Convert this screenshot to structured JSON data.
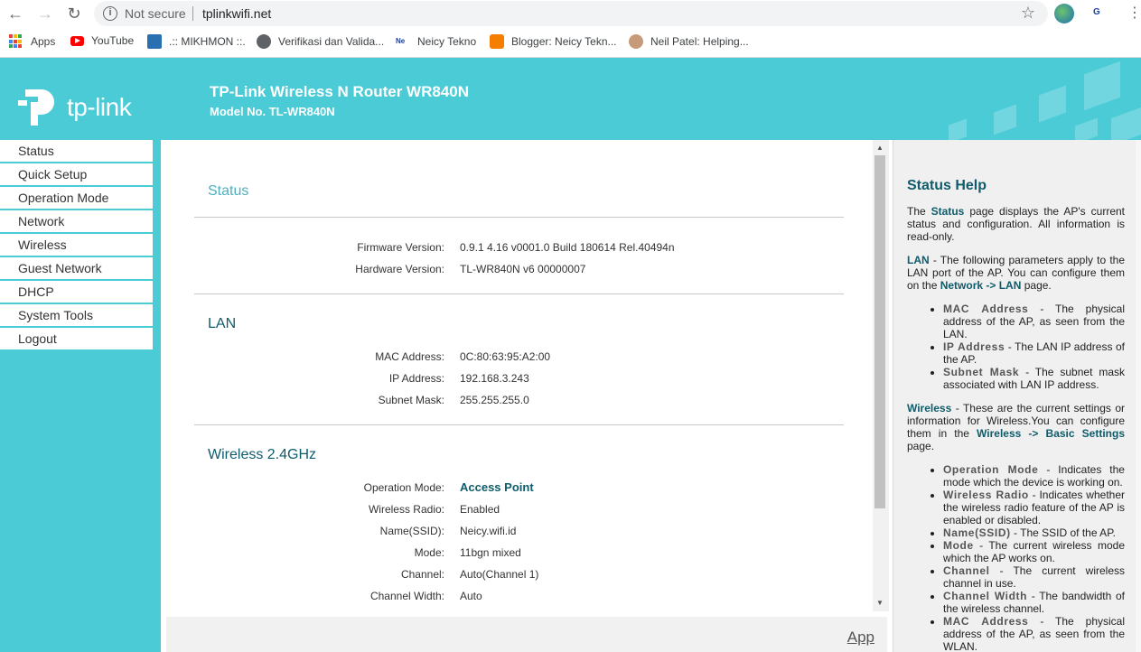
{
  "browser": {
    "not_secure": "Not secure",
    "url": "tplinkwifi.net",
    "bookmarks": [
      "Apps",
      "YouTube",
      ".:: MIKHMON ::.",
      "Verifikasi dan Valida...",
      "Neicy Tekno",
      "Blogger: Neicy Tekn...",
      "Neil Patel: Helping..."
    ]
  },
  "header": {
    "logo_text": "tp-link",
    "title": "TP-Link Wireless N Router WR840N",
    "model": "Model No. TL-WR840N"
  },
  "sidebar": {
    "items": [
      "Status",
      "Quick Setup",
      "Operation Mode",
      "Network",
      "Wireless",
      "Guest Network",
      "DHCP",
      "System Tools",
      "Logout"
    ]
  },
  "status": {
    "title": "Status",
    "firmware_label": "Firmware Version:",
    "firmware_value": "0.9.1 4.16 v0001.0 Build 180614 Rel.40494n",
    "hardware_label": "Hardware Version:",
    "hardware_value": "TL-WR840N v6 00000007"
  },
  "lan": {
    "title": "LAN",
    "mac_label": "MAC Address:",
    "mac_value": "0C:80:63:95:A2:00",
    "ip_label": "IP Address:",
    "ip_value": "192.168.3.243",
    "mask_label": "Subnet Mask:",
    "mask_value": "255.255.255.0"
  },
  "wireless": {
    "title": "Wireless 2.4GHz",
    "opmode_label": "Operation Mode:",
    "opmode_value": "Access Point",
    "radio_label": "Wireless Radio:",
    "radio_value": "Enabled",
    "ssid_label": "Name(SSID):",
    "ssid_value": "Neicy.wifi.id",
    "mode_label": "Mode:",
    "mode_value": "11bgn mixed",
    "channel_label": "Channel:",
    "channel_value": "Auto(Channel 1)",
    "width_label": "Channel Width:",
    "width_value": "Auto"
  },
  "footer": {
    "link": "App"
  },
  "help": {
    "title": "Status Help",
    "intro_1": "The ",
    "intro_b": "Status",
    "intro_2": " page displays the AP's current status and configuration. All information is read-only.",
    "lan_b": "LAN",
    "lan_1": " - The following parameters apply to the LAN port of the AP. You can configure them on the ",
    "lan_link": "Network -> LAN",
    "lan_2": " page.",
    "lan_items": [
      {
        "name": "MAC Address",
        "desc": " - The physical address of the AP, as seen from the LAN."
      },
      {
        "name": "IP Address",
        "desc": " - The LAN IP address of the AP."
      },
      {
        "name": "Subnet Mask",
        "desc": " - The subnet mask associated with LAN IP address."
      }
    ],
    "wl_b": "Wireless",
    "wl_1": " - These are the current settings or information for Wireless.You can configure them in the ",
    "wl_link": "Wireless -> Basic Settings",
    "wl_2": " page.",
    "wl_items": [
      {
        "name": "Operation Mode",
        "desc": " - Indicates the mode which the device is working on."
      },
      {
        "name": "Wireless Radio",
        "desc": " - Indicates whether the wireless radio feature of the AP is enabled or disabled."
      },
      {
        "name": "Name(SSID)",
        "desc": " - The SSID of the AP."
      },
      {
        "name": "Mode",
        "desc": " - The current wireless mode which the AP works on."
      },
      {
        "name": "Channel",
        "desc": " - The current wireless channel in use."
      },
      {
        "name": "Channel Width",
        "desc": " - The bandwidth of the wireless channel."
      },
      {
        "name": "MAC Address",
        "desc": " - The physical address of the AP, as seen from the WLAN."
      }
    ]
  },
  "colors": {
    "brand": "#4acbd6",
    "heading": "#0e5c6b"
  }
}
